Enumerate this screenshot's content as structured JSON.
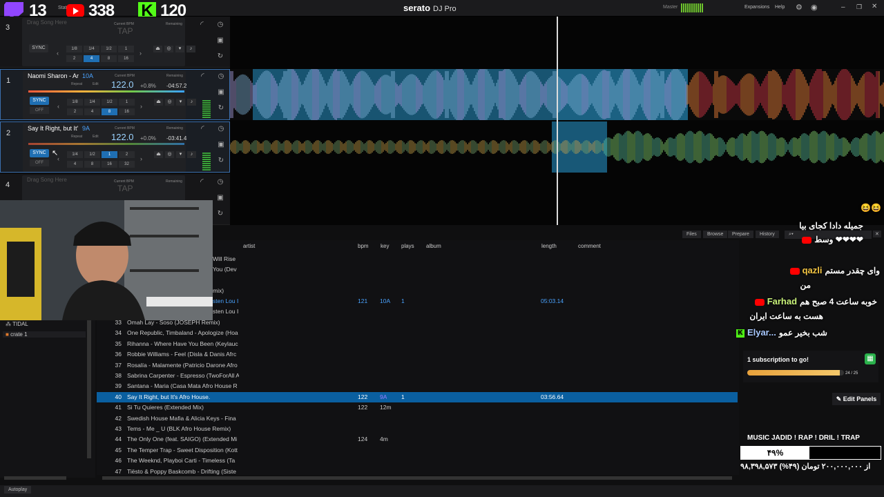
{
  "app": {
    "brand": "serato",
    "product": "DJ Pro",
    "master_label": "Master",
    "menu": [
      "Expansions",
      "Help"
    ]
  },
  "counters": {
    "twitch": "13",
    "youtube": "338",
    "kick": "120",
    "stat_label": "Stat"
  },
  "decks": [
    {
      "num": "3",
      "drag": "Drag Song Here",
      "tap": "TAP",
      "bpm_label": "Current BPM",
      "rem_label": "Remaining",
      "sync": "SYNC",
      "loops": [
        "1/8",
        "1/4",
        "1/2",
        "1",
        "2",
        "4",
        "8",
        "16"
      ]
    },
    {
      "num": "1",
      "title": "Naomi Sharon - Ar",
      "key": "10A",
      "bpm_label": "Current BPM",
      "rem_label": "Remaining",
      "bpm": "122.0",
      "pitch": "+0.8%",
      "remaining": "-04:57.2",
      "repeat": "Repeat",
      "edit": "Edit",
      "sync": "SYNC",
      "off": "OFF",
      "loops": [
        "1/8",
        "1/4",
        "1/2",
        "1",
        "2",
        "4",
        "8",
        "16"
      ]
    },
    {
      "num": "2",
      "title": "Say It Right, but It'",
      "key": "9A",
      "bpm_label": "Current BPM",
      "rem_label": "Remaining",
      "bpm": "122.0",
      "pitch": "+0.0%",
      "remaining": "-03:41.4",
      "repeat": "Repeat",
      "edit": "Edit",
      "sync": "SYNC",
      "off": "OFF",
      "loops": [
        "1/4",
        "1/2",
        "1",
        "2",
        "4",
        "8",
        "16",
        "32"
      ]
    },
    {
      "num": "4",
      "drag": "Drag Song Here",
      "tap": "TAP",
      "bpm_label": "Current BPM",
      "rem_label": "Remaining"
    }
  ],
  "library": {
    "tabs": [
      "Files",
      "Browse",
      "Prepare",
      "History"
    ],
    "columns": {
      "artist": "artist",
      "bpm": "bpm",
      "key": "key",
      "plays": "plays",
      "album": "album",
      "length": "length",
      "comment": "comment"
    },
    "crates": [
      "TIDAL",
      "crate 1"
    ],
    "partial_rows": [
      "Will Rise",
      "You (Dev",
      "mix)",
      "sten Lou I",
      "sten Lou I"
    ],
    "partial_row_values": {
      "bpm": "121",
      "key": "10A",
      "plays": "1",
      "length": "05:03.14"
    },
    "rows": [
      {
        "n": "33",
        "title": "Omah Lay - Soso (JOSEPH Remix)",
        "bpm": "",
        "key": "",
        "plays": "",
        "length": ""
      },
      {
        "n": "34",
        "title": "One Republic, Timbaland - Apologize (Hoa",
        "bpm": "",
        "key": "",
        "plays": "",
        "length": ""
      },
      {
        "n": "35",
        "title": "Rihanna - Where Have You Been (Keylauc",
        "bpm": "",
        "key": "",
        "plays": "",
        "length": ""
      },
      {
        "n": "36",
        "title": "Robbie Williams - Feel (Disla & Danis Afrc",
        "bpm": "",
        "key": "",
        "plays": "",
        "length": ""
      },
      {
        "n": "37",
        "title": "Rosalía - Malamente (Patricio Darone Afro",
        "bpm": "",
        "key": "",
        "plays": "",
        "length": ""
      },
      {
        "n": "38",
        "title": "Sabrina Carpenter - Espresso (TwoForAll A",
        "bpm": "",
        "key": "",
        "plays": "",
        "length": ""
      },
      {
        "n": "39",
        "title": "Santana - Maria (Casa Mata Afro House R",
        "bpm": "",
        "key": "",
        "plays": "",
        "length": ""
      },
      {
        "n": "40",
        "title": "Say It Right, but It's Afro House.",
        "bpm": "122",
        "key": "9A",
        "plays": "1",
        "length": "03:56.64"
      },
      {
        "n": "41",
        "title": "Si Tu Quieres (Extended Mix)",
        "bpm": "122",
        "key": "12m",
        "plays": "",
        "length": ""
      },
      {
        "n": "42",
        "title": "Swedish House Mafia & Alicia Keys - Fina",
        "bpm": "",
        "key": "",
        "plays": "",
        "length": ""
      },
      {
        "n": "43",
        "title": "Tems - Me _ U (BLK Afro House Remix)",
        "bpm": "",
        "key": "",
        "plays": "",
        "length": ""
      },
      {
        "n": "44",
        "title": "The Only One (feat. SAIGO) (Extended Mi",
        "bpm": "124",
        "key": "4m",
        "plays": "",
        "length": ""
      },
      {
        "n": "45",
        "title": "The Temper Trap - Sweet Disposition (Kott",
        "bpm": "",
        "key": "",
        "plays": "",
        "length": ""
      },
      {
        "n": "46",
        "title": "The Weeknd, Playboi Carti - Timeless (Ta",
        "bpm": "",
        "key": "",
        "plays": "",
        "length": ""
      },
      {
        "n": "47",
        "title": "Tiësto & Poppy Baskcomb - Drifting (Siste",
        "bpm": "",
        "key": "",
        "plays": "",
        "length": ""
      }
    ]
  },
  "chat": [
    {
      "platform": "none",
      "user": "",
      "msg": "جمیله دادا کجای بیا"
    },
    {
      "platform": "youtube",
      "user": "",
      "msg": "وسط"
    },
    {
      "platform": "youtube",
      "user": "qazli",
      "msg": "وای چقدر مستم"
    },
    {
      "platform": "none",
      "user": "",
      "msg": "من"
    },
    {
      "platform": "youtube",
      "user": "Farhad",
      "msg": "خوبه ساعت 4 صبح هم"
    },
    {
      "platform": "none",
      "user": "",
      "msg": "هست به ساعت ایران"
    },
    {
      "platform": "kick",
      "user": "Elyar...",
      "msg": "شب بخیر عمو"
    }
  ],
  "goal": {
    "text": "1 subscription to go!",
    "count": "24 / 25",
    "fraction": 0.96
  },
  "edit_panels": "Edit Panels",
  "donation": {
    "title": "MUSIC JADID ! RAP ! DRIL ! TRAP",
    "percent_text": "۴۹%",
    "fraction": 0.49,
    "detail": "۹۸,۳۹۸,۵۷۳ از ۲۰۰,۰۰۰,۰۰۰ تومان (۴۹%)"
  },
  "bottom": {
    "autoplay": "Autoplay"
  }
}
